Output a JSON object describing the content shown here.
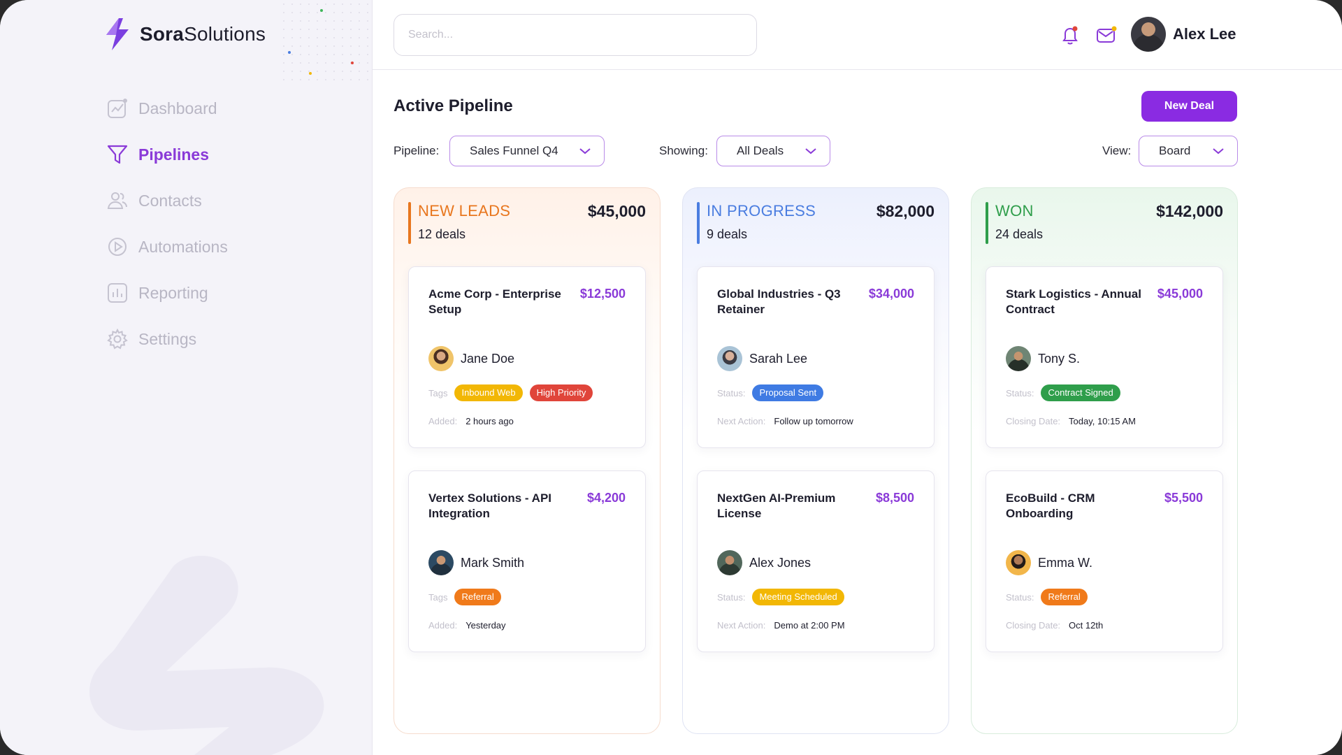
{
  "app": {
    "logo_bold": "Sora",
    "logo_rest": "Solutions"
  },
  "sidebar": {
    "items": [
      {
        "label": "Dashboard",
        "icon": "chart-icon",
        "active": false
      },
      {
        "label": "Pipelines",
        "icon": "funnel-icon",
        "active": true
      },
      {
        "label": "Contacts",
        "icon": "users-icon",
        "active": false
      },
      {
        "label": "Automations",
        "icon": "play-circle-icon",
        "active": false
      },
      {
        "label": "Reporting",
        "icon": "bar-chart-icon",
        "active": false
      },
      {
        "label": "Settings",
        "icon": "gear-icon",
        "active": false
      }
    ]
  },
  "header": {
    "search_placeholder": "Search...",
    "user_name": "Alex Lee"
  },
  "page": {
    "title": "Active Pipeline",
    "new_button": "New Deal",
    "pipeline_label": "Pipeline:",
    "pipeline_value": "Sales Funnel Q4",
    "showing_label": "Showing:",
    "showing_value": "All Deals",
    "view_label": "View:",
    "view_value": "Board"
  },
  "colors": {
    "accent": "#8a2be2",
    "leads": "#e8761e",
    "progress": "#4a7de0",
    "won": "#2f9e4b"
  },
  "columns": [
    {
      "title": "NEW LEADS",
      "count": "12 deals",
      "total": "$45,000",
      "cards": [
        {
          "title": "Acme Corp - Enterprise Setup",
          "amount": "$12,500",
          "person": "Jane Doe",
          "tag_label": "Tags",
          "tags": [
            {
              "text": "Inbound Web",
              "color": "#f2b705"
            },
            {
              "text": "High Priority",
              "color": "#e0453a"
            }
          ],
          "meta_label": "Added:",
          "meta_value": "2 hours ago"
        },
        {
          "title": "Vertex Solutions - API Integration",
          "amount": "$4,200",
          "person": "Mark Smith",
          "tag_label": "Tags",
          "tags": [
            {
              "text": "Referral",
              "color": "#f07a1a"
            }
          ],
          "meta_label": "Added:",
          "meta_value": "Yesterday"
        }
      ]
    },
    {
      "title": "IN PROGRESS",
      "count": "9 deals",
      "total": "$82,000",
      "cards": [
        {
          "title": "Global Industries - Q3 Retainer",
          "amount": "$34,000",
          "person": "Sarah Lee",
          "tag_label": "Status:",
          "tags": [
            {
              "text": "Proposal Sent",
              "color": "#3f7be3"
            }
          ],
          "meta_label": "Next Action:",
          "meta_value": "Follow up tomorrow"
        },
        {
          "title": "NextGen AI-Premium License",
          "amount": "$8,500",
          "person": "Alex Jones",
          "tag_label": "Status:",
          "tags": [
            {
              "text": "Meeting Scheduled",
              "color": "#f2b705"
            }
          ],
          "meta_label": "Next Action:",
          "meta_value": "Demo at 2:00 PM"
        }
      ]
    },
    {
      "title": "WON",
      "count": "24 deals",
      "total": "$142,000",
      "cards": [
        {
          "title": "Stark Logistics - Annual Contract",
          "amount": "$45,000",
          "person": "Tony S.",
          "tag_label": "Status:",
          "tags": [
            {
              "text": "Contract Signed",
              "color": "#2f9e4b"
            }
          ],
          "meta_label": "Closing Date:",
          "meta_value": "Today, 10:15 AM"
        },
        {
          "title": "EcoBuild - CRM Onboarding",
          "amount": "$5,500",
          "person": "Emma W.",
          "tag_label": "Status:",
          "tags": [
            {
              "text": "Referral",
              "color": "#f07a1a"
            }
          ],
          "meta_label": "Closing Date:",
          "meta_value": "Oct 12th"
        }
      ]
    }
  ]
}
